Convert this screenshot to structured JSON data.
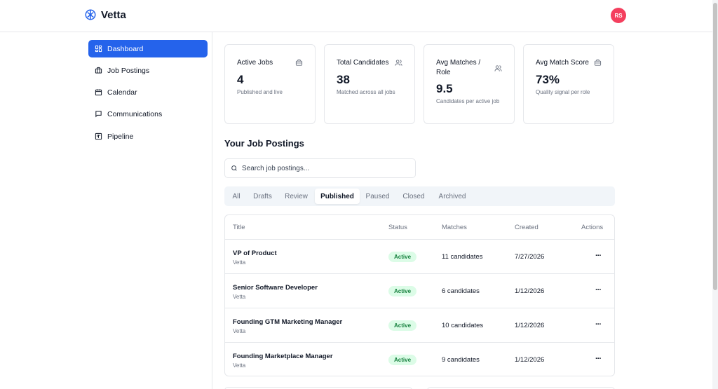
{
  "app": {
    "name": "Vetta",
    "user_initials": "RS"
  },
  "sidebar": {
    "items": [
      {
        "label": "Dashboard",
        "icon": "dashboard-icon",
        "active": true
      },
      {
        "label": "Job Postings",
        "icon": "briefcase-icon"
      },
      {
        "label": "Calendar",
        "icon": "calendar-icon"
      },
      {
        "label": "Communications",
        "icon": "chat-icon"
      },
      {
        "label": "Pipeline",
        "icon": "pipeline-icon"
      }
    ]
  },
  "stats": [
    {
      "title": "Active Jobs",
      "value": "4",
      "sub": "Published and live",
      "icon": "briefcase-icon"
    },
    {
      "title": "Total Candidates",
      "value": "38",
      "sub": "Matched across all jobs",
      "icon": "users-icon"
    },
    {
      "title": "Avg Matches / Role",
      "value": "9.5",
      "sub": "Candidates per active job",
      "icon": "users-icon"
    },
    {
      "title": "Avg Match Score",
      "value": "73%",
      "sub": "Quality signal per role",
      "icon": "briefcase-icon"
    }
  ],
  "postings": {
    "section_title": "Your Job Postings",
    "search_placeholder": "Search job postings...",
    "tabs": [
      "All",
      "Drafts",
      "Review",
      "Published",
      "Paused",
      "Closed",
      "Archived"
    ],
    "active_tab": "Published",
    "columns": {
      "title": "Title",
      "status": "Status",
      "matches": "Matches",
      "created": "Created",
      "actions": "Actions"
    },
    "rows": [
      {
        "title": "VP of Product",
        "company": "Vetta",
        "status": "Active",
        "matches": "11 candidates",
        "created": "7/27/2026"
      },
      {
        "title": "Senior Software Developer",
        "company": "Vetta",
        "status": "Active",
        "matches": "6 candidates",
        "created": "1/12/2026"
      },
      {
        "title": "Founding GTM Marketing Manager",
        "company": "Vetta",
        "status": "Active",
        "matches": "10 candidates",
        "created": "1/12/2026"
      },
      {
        "title": "Founding Marketplace Manager",
        "company": "Vetta",
        "status": "Active",
        "matches": "9 candidates",
        "created": "1/12/2026"
      }
    ],
    "menu_glyph": "···"
  },
  "colors": {
    "accent": "#2563eb",
    "avatar": "#f43f5e",
    "badge_bg": "#dcfce7",
    "badge_text": "#15803d"
  }
}
